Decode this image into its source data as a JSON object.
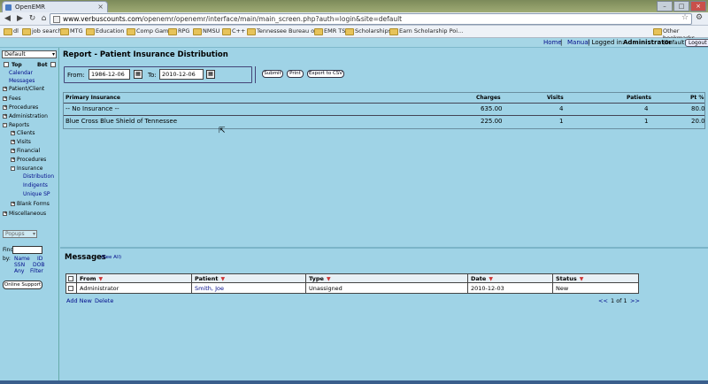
{
  "browser": {
    "tab_title": "OpenEMR",
    "url_domain": "www.verbuscounts.com",
    "url_path": "/openemr/openemr/interface/main/main_screen.php?auth=login&site=default",
    "bookmarks": [
      "dl",
      "job search",
      "MTG",
      "Education",
      "Comp Game",
      "RPG",
      "NMSU",
      "C++",
      "Tennessee Bureau o...",
      "EMR TS",
      "Scholarships",
      "Earn Scholarship Poi..."
    ],
    "other_bookmarks": "Other bookmarks"
  },
  "topbar": {
    "home": "Home",
    "manual": "Manual",
    "logged_in_prefix": "Logged in:",
    "user": "Administrator",
    "facility": "(Default)",
    "logout": "Logout"
  },
  "nav": {
    "select_value": "Default",
    "top": "Top",
    "bot": "Bot",
    "calendar": "Calendar",
    "messages": "Messages",
    "patient_client": "Patient/Client",
    "fees": "Fees",
    "procedures": "Procedures",
    "administration": "Administration",
    "reports": "Reports",
    "clients": "Clients",
    "visits": "Visits",
    "financial": "Financial",
    "procedures_sub": "Procedures",
    "insurance": "Insurance",
    "distribution": "Distribution",
    "indigents": "Indigents",
    "unique_sp": "Unique SP",
    "blank_forms": "Blank Forms",
    "miscellaneous": "Miscellaneous",
    "popups": "Popups",
    "find": "Find:",
    "by": "by:",
    "name": "Name",
    "id": "ID",
    "ssn": "SSN",
    "dob": "DOB",
    "any": "Any",
    "filter": "Filter",
    "online_support": "Online Support"
  },
  "report": {
    "title": "Report - Patient Insurance Distribution",
    "from_label": "From:",
    "from_value": "1986-12-06",
    "to_label": "To:",
    "to_value": "2010-12-06",
    "submit": "Submit",
    "print": "Print",
    "export": "Export to CSV",
    "columns": {
      "insurance": "Primary Insurance",
      "charges": "Charges",
      "visits": "Visits",
      "patients": "Patients",
      "pct": "Pt %"
    },
    "rows": [
      {
        "insurance": "-- No Insurance --",
        "charges": "635.00",
        "visits": "4",
        "patients": "4",
        "pct": "80.0"
      },
      {
        "insurance": "Blue Cross Blue Shield of Tennessee",
        "charges": "225.00",
        "visits": "1",
        "patients": "1",
        "pct": "20.0"
      }
    ]
  },
  "messages": {
    "title": "Messages",
    "see_all": "(See All)",
    "columns": {
      "from": "From",
      "patient": "Patient",
      "type": "Type",
      "date": "Date",
      "status": "Status"
    },
    "rows": [
      {
        "from": "Administrator",
        "patient": "Smith, Joe",
        "type": "Unassigned",
        "date": "2010-12-03",
        "status": "New"
      }
    ],
    "add_new": "Add New",
    "delete": "Delete",
    "pager_prev": "<<",
    "pager": "1 of 1",
    "pager_next": ">>"
  },
  "colors": {
    "frame_bg": "#9fd3e6",
    "link": "#000a8a"
  }
}
